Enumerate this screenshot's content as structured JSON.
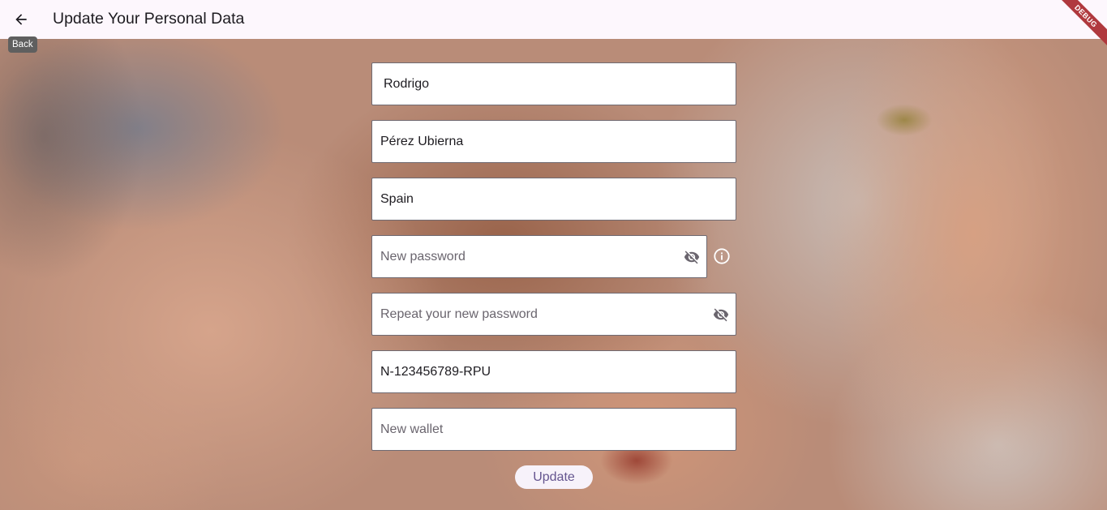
{
  "appbar": {
    "title": "Update Your Personal Data",
    "back_tooltip": "Back",
    "back_icon": "arrow-left-icon",
    "debug_label": "DEBUG",
    "background_color": "#fdf7fd"
  },
  "form": {
    "first_name": {
      "value": "Rodrigo",
      "placeholder": ""
    },
    "last_name": {
      "value": "Pérez Ubierna",
      "placeholder": ""
    },
    "country": {
      "value": "Spain",
      "placeholder": ""
    },
    "new_password": {
      "value": "",
      "placeholder": "New password",
      "icon": "visibility-off-icon"
    },
    "repeat_password": {
      "value": "",
      "placeholder": "Repeat your new password",
      "icon": "visibility-off-icon"
    },
    "wallet_current": {
      "value": "N-123456789-RPU",
      "placeholder": ""
    },
    "new_wallet": {
      "value": "",
      "placeholder": "New wallet"
    },
    "password_info_icon": "info-icon"
  },
  "actions": {
    "update_label": "Update",
    "update_color": "#65558f"
  }
}
